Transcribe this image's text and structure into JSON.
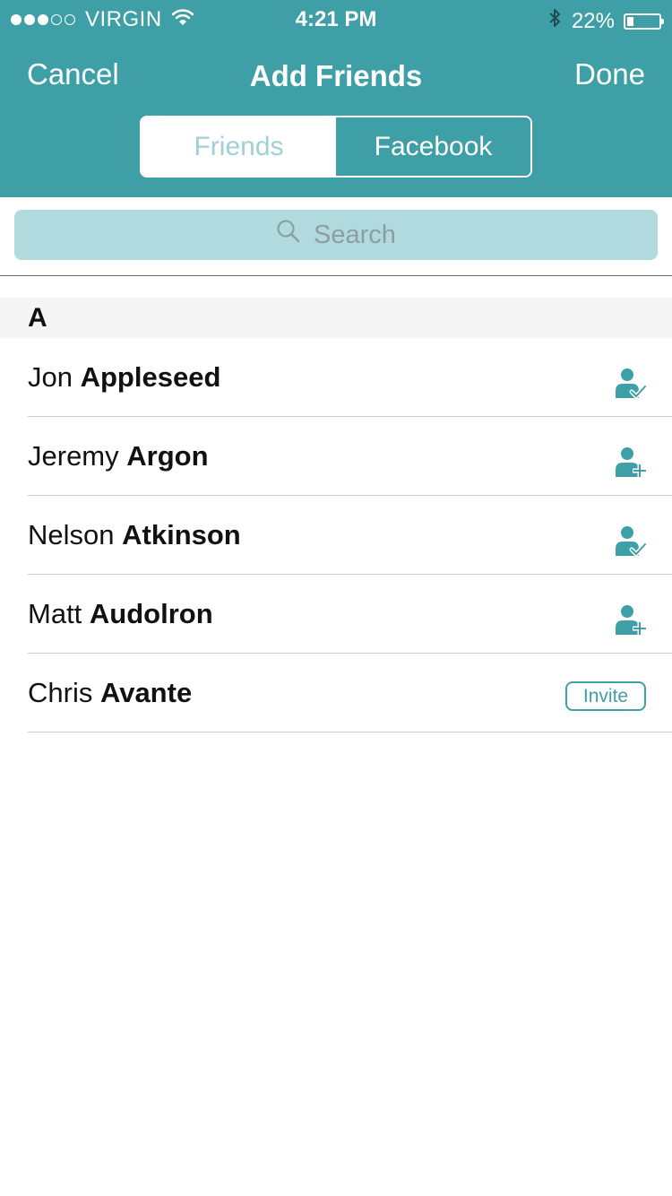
{
  "status_bar": {
    "signal_bars_filled": 3,
    "signal_bars_total": 5,
    "carrier": "VIRGIN",
    "time": "4:21 PM",
    "battery_text": "22%",
    "battery_level": 0.22
  },
  "nav": {
    "cancel_label": "Cancel",
    "title": "Add Friends",
    "done_label": "Done"
  },
  "segments": [
    {
      "label": "Friends",
      "selected": true
    },
    {
      "label": "Facebook",
      "selected": false
    }
  ],
  "search": {
    "placeholder": "Search"
  },
  "section": {
    "letter": "A"
  },
  "contacts": [
    {
      "first": "Jon",
      "last": "Appleseed",
      "action": "added",
      "icon": "person-check-icon"
    },
    {
      "first": "Jeremy",
      "last": "Argon",
      "action": "add",
      "icon": "person-add-icon"
    },
    {
      "first": "Nelson",
      "last": "Atkinson",
      "action": "added",
      "icon": "person-check-icon"
    },
    {
      "first": "Matt",
      "last": "Audolron",
      "action": "add",
      "icon": "person-add-icon"
    },
    {
      "first": "Chris",
      "last": "Avante",
      "action": "invite",
      "invite_label": "Invite"
    }
  ],
  "colors": {
    "accent": "#3e9fa6",
    "search_bg": "#b1dadf",
    "segment_selected_text": "#9fd0d6"
  }
}
